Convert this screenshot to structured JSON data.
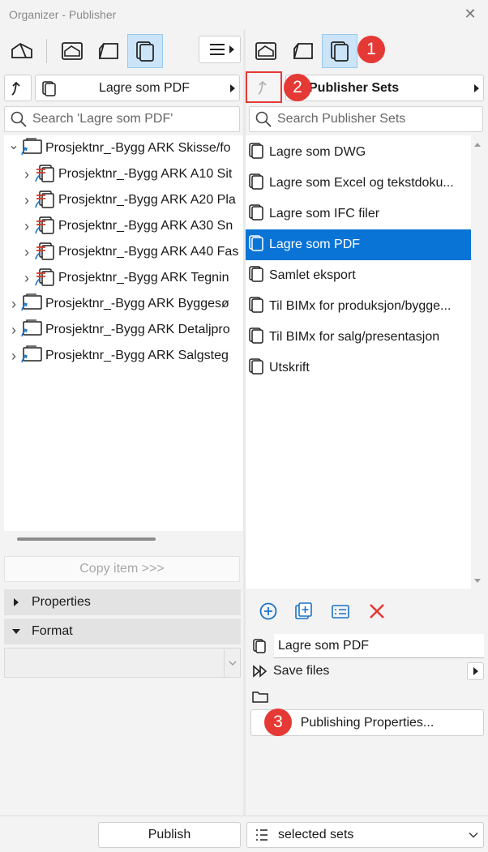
{
  "window": {
    "title": "Organizer - Publisher",
    "close_glyph": "✕"
  },
  "left": {
    "dropdown_label": "Lagre som PDF",
    "search_placeholder": "Search 'Lagre som PDF'",
    "tree": [
      {
        "label": "Prosjektnr_-Bygg ARK  Skisse/fo",
        "level": 0,
        "expanded": true
      },
      {
        "label": "Prosjektnr_-Bygg ARK A10 Sit",
        "level": 1,
        "expanded": false
      },
      {
        "label": "Prosjektnr_-Bygg ARK A20 Pla",
        "level": 1,
        "expanded": false
      },
      {
        "label": "Prosjektnr_-Bygg ARK A30 Sn",
        "level": 1,
        "expanded": false
      },
      {
        "label": "Prosjektnr_-Bygg ARK A40 Fas",
        "level": 1,
        "expanded": false
      },
      {
        "label": "Prosjektnr_-Bygg ARK  Tegnin",
        "level": 1,
        "expanded": false
      },
      {
        "label": "Prosjektnr_-Bygg ARK  Byggesø",
        "level": 0,
        "expanded": false
      },
      {
        "label": "Prosjektnr_-Bygg ARK  Detaljpro",
        "level": 0,
        "expanded": false
      },
      {
        "label": "Prosjektnr_-Bygg ARK  Salgsteg",
        "level": 0,
        "expanded": false
      }
    ],
    "copy_button": "Copy item >>>",
    "properties_label": "Properties",
    "format_label": "Format",
    "format_value": ""
  },
  "right": {
    "header_label": "Publisher Sets",
    "search_placeholder": "Search Publisher Sets",
    "sets": [
      {
        "label": "Lagre som DWG",
        "selected": false
      },
      {
        "label": "Lagre som Excel og tekstdoku...",
        "selected": false
      },
      {
        "label": "Lagre som IFC filer",
        "selected": false
      },
      {
        "label": "Lagre som PDF",
        "selected": true
      },
      {
        "label": "Samlet eksport",
        "selected": false
      },
      {
        "label": "Til BIMx for produksjon/bygge...",
        "selected": false
      },
      {
        "label": "Til BIMx for salg/presentasjon",
        "selected": false
      },
      {
        "label": "Utskrift",
        "selected": false
      }
    ],
    "name_field_value": "Lagre som PDF",
    "save_files_label": "Save files",
    "publishing_properties_label": "Publishing Properties..."
  },
  "footer": {
    "publish_label": "Publish",
    "scope_value": "selected sets"
  },
  "badges": {
    "one": "1",
    "two": "2",
    "three": "3"
  },
  "colors": {
    "accent": "#0a74d6",
    "badge": "#e53935",
    "highlight_box": "#e53935",
    "delete": "#e53935"
  }
}
